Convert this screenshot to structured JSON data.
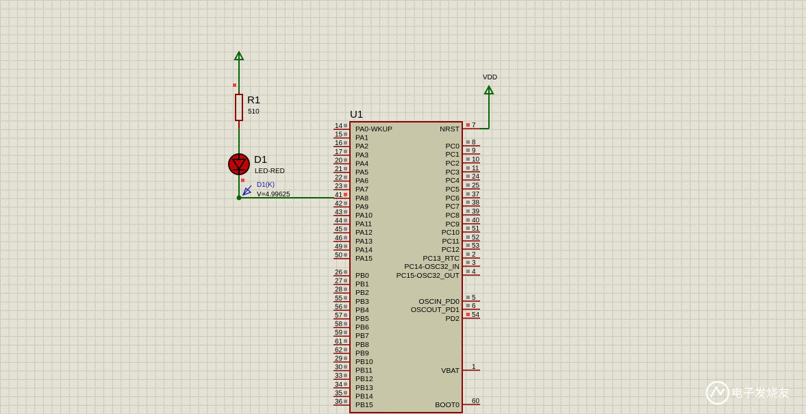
{
  "u1": {
    "ref": "U1",
    "left_pins": [
      {
        "num": "14",
        "name": "PA0-WKUP"
      },
      {
        "num": "15",
        "name": "PA1"
      },
      {
        "num": "16",
        "name": "PA2"
      },
      {
        "num": "17",
        "name": "PA3"
      },
      {
        "num": "20",
        "name": "PA4"
      },
      {
        "num": "21",
        "name": "PA5"
      },
      {
        "num": "22",
        "name": "PA6"
      },
      {
        "num": "23",
        "name": "PA7"
      },
      {
        "num": "41",
        "name": "PA8"
      },
      {
        "num": "42",
        "name": "PA9"
      },
      {
        "num": "43",
        "name": "PA10"
      },
      {
        "num": "44",
        "name": "PA11"
      },
      {
        "num": "45",
        "name": "PA12"
      },
      {
        "num": "46",
        "name": "PA13"
      },
      {
        "num": "49",
        "name": "PA14"
      },
      {
        "num": "50",
        "name": "PA15"
      },
      {
        "num": "26",
        "name": "PB0"
      },
      {
        "num": "27",
        "name": "PB1"
      },
      {
        "num": "28",
        "name": "PB2"
      },
      {
        "num": "55",
        "name": "PB3"
      },
      {
        "num": "56",
        "name": "PB4"
      },
      {
        "num": "57",
        "name": "PB5"
      },
      {
        "num": "58",
        "name": "PB6"
      },
      {
        "num": "59",
        "name": "PB7"
      },
      {
        "num": "61",
        "name": "PB8"
      },
      {
        "num": "62",
        "name": "PB9"
      },
      {
        "num": "29",
        "name": "PB10"
      },
      {
        "num": "30",
        "name": "PB11"
      },
      {
        "num": "33",
        "name": "PB12"
      },
      {
        "num": "34",
        "name": "PB13"
      },
      {
        "num": "35",
        "name": "PB14"
      },
      {
        "num": "36",
        "name": "PB15"
      }
    ],
    "right_pins": [
      {
        "num": "7",
        "name": "NRST"
      },
      {
        "num": "8",
        "name": "PC0"
      },
      {
        "num": "9",
        "name": "PC1"
      },
      {
        "num": "10",
        "name": "PC2"
      },
      {
        "num": "11",
        "name": "PC3"
      },
      {
        "num": "24",
        "name": "PC4"
      },
      {
        "num": "25",
        "name": "PC5"
      },
      {
        "num": "37",
        "name": "PC6"
      },
      {
        "num": "38",
        "name": "PC7"
      },
      {
        "num": "39",
        "name": "PC8"
      },
      {
        "num": "40",
        "name": "PC9"
      },
      {
        "num": "51",
        "name": "PC10"
      },
      {
        "num": "52",
        "name": "PC11"
      },
      {
        "num": "53",
        "name": "PC12"
      },
      {
        "num": "2",
        "name": "PC13_RTC"
      },
      {
        "num": "3",
        "name": "PC14-OSC32_IN"
      },
      {
        "num": "4",
        "name": "PC15-OSC32_OUT"
      },
      {
        "num": "5",
        "name": "OSCIN_PD0"
      },
      {
        "num": "6",
        "name": "OSCOUT_PD1"
      },
      {
        "num": "54",
        "name": "PD2"
      },
      {
        "num": "1",
        "name": "VBAT"
      },
      {
        "num": "60",
        "name": "BOOT0"
      }
    ]
  },
  "r1": {
    "ref": "R1",
    "value": "510"
  },
  "d1": {
    "ref": "D1",
    "value": "LED-RED"
  },
  "probe": {
    "label": "D1(K)",
    "reading": "V=4.99625"
  },
  "vdd_label": "VDD",
  "watermark": "电子发烧友",
  "colors": {
    "wire": "#006400",
    "pin": "#8b0000",
    "chip_body": "#c8c6a8",
    "logic_high": "#ff4040",
    "probe": "#1a1ab0"
  }
}
